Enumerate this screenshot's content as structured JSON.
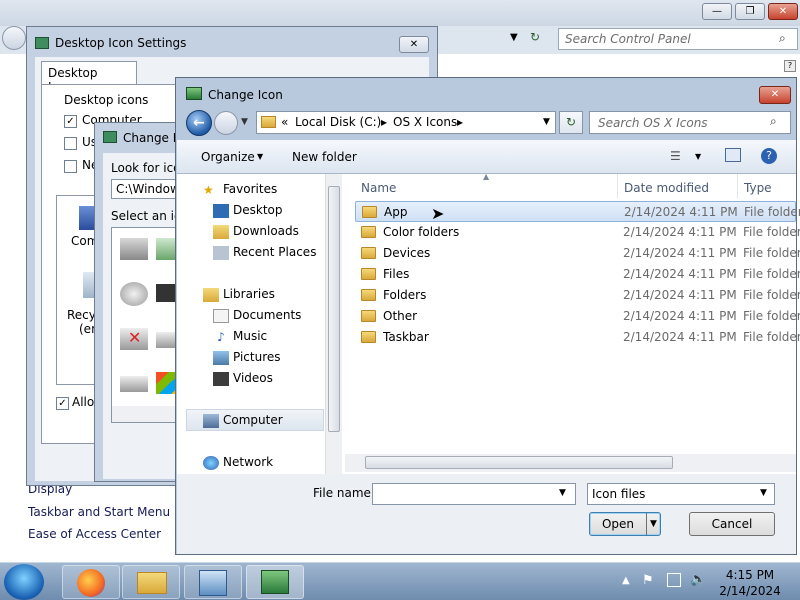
{
  "control_panel": {
    "search_placeholder": "Search Control Panel",
    "links": [
      "Display",
      "Taskbar and Start Menu",
      "Ease of Access Center"
    ]
  },
  "desktop_icon_settings": {
    "title": "Desktop Icon Settings",
    "tab": "Desktop Icons",
    "group_label": "Desktop icons",
    "checkboxes": [
      {
        "label": "Computer",
        "checked": true
      },
      {
        "label": "Use",
        "checked": false
      },
      {
        "label": "Ne",
        "checked": false
      }
    ],
    "icon_labels": [
      "Comp",
      "Recyc",
      "(emp"
    ],
    "allow_label": "Allow",
    "allow_checked": true
  },
  "change_icon_small": {
    "title": "Change Ic",
    "look_for_label": "Look for icons",
    "path_value": "C:\\Windows",
    "select_label": "Select an icon"
  },
  "change_icon": {
    "title": "Change Icon",
    "breadcrumb": [
      "Local Disk (C:)",
      "OS X Icons"
    ],
    "breadcrumb_prefix": "«",
    "search_placeholder": "Search OS X Icons",
    "toolbar": {
      "organize": "Organize",
      "new_folder": "New folder"
    },
    "nav": {
      "favorites": "Favorites",
      "desktop": "Desktop",
      "downloads": "Downloads",
      "recent": "Recent Places",
      "libraries": "Libraries",
      "documents": "Documents",
      "music": "Music",
      "pictures": "Pictures",
      "videos": "Videos",
      "computer": "Computer",
      "network": "Network"
    },
    "columns": {
      "name": "Name",
      "date": "Date modified",
      "type": "Type"
    },
    "files": [
      {
        "name": "App",
        "date": "2/14/2024 4:11 PM",
        "type": "File folder"
      },
      {
        "name": "Color folders",
        "date": "2/14/2024 4:11 PM",
        "type": "File folder"
      },
      {
        "name": "Devices",
        "date": "2/14/2024 4:11 PM",
        "type": "File folder"
      },
      {
        "name": "Files",
        "date": "2/14/2024 4:11 PM",
        "type": "File folder"
      },
      {
        "name": "Folders",
        "date": "2/14/2024 4:11 PM",
        "type": "File folder"
      },
      {
        "name": "Other",
        "date": "2/14/2024 4:11 PM",
        "type": "File folder"
      },
      {
        "name": "Taskbar",
        "date": "2/14/2024 4:11 PM",
        "type": "File folder"
      }
    ],
    "file_name_label": "File name:",
    "file_name_value": "",
    "file_type": "Icon files",
    "open_label": "Open",
    "cancel_label": "Cancel"
  },
  "taskbar": {
    "time": "4:15 PM",
    "date": "2/14/2024"
  },
  "colors": {
    "selection": "#cfe0f5",
    "taskbar": "#6f8cae"
  }
}
